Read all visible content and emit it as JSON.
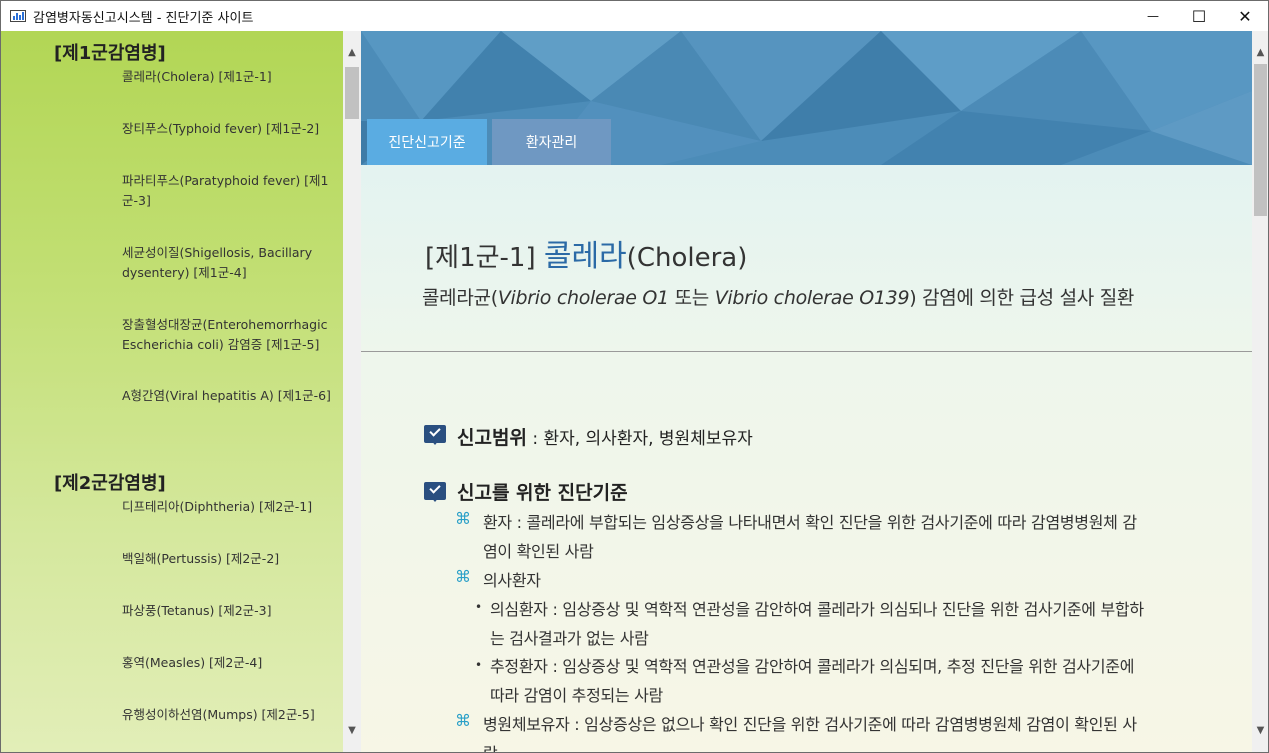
{
  "window": {
    "title": "감염병자동신고시스템 - 진단기준 사이트",
    "minimize_glyph": "—",
    "maximize_glyph": "☐",
    "close_glyph": "✕"
  },
  "sidebar": {
    "groups": [
      {
        "title": "[제1군감염병]",
        "items": [
          "콜레라(Cholera) [제1군-1]",
          "장티푸스(Typhoid fever) [제1군-2]",
          "파라티푸스(Paratyphoid fever) [제1군-3]",
          "세균성이질(Shigellosis, Bacillary dysentery) [제1군-4]",
          "장출혈성대장균(Enterohemorrhagic Escherichia coli) 감염증 [제1군-5]",
          "A형간염(Viral hepatitis A) [제1군-6]"
        ]
      },
      {
        "title": "[제2군감염병]",
        "items": [
          "디프테리아(Diphtheria) [제2군-1]",
          "백일해(Pertussis) [제2군-2]",
          "파상풍(Tetanus) [제2군-3]",
          "홍역(Measles) [제2군-4]",
          "유행성이하선염(Mumps) [제2군-5]"
        ]
      }
    ]
  },
  "tabs": {
    "active": "진단신고기준",
    "inactive": "환자관리"
  },
  "disease": {
    "code": "[제1군-1]",
    "name_ko": "콜레라",
    "name_en": "(Cholera)",
    "desc_pre": "콜레라균(",
    "desc_em1": "Vibrio cholerae O1",
    "desc_mid": " 또는 ",
    "desc_em2": "Vibrio cholerae O139",
    "desc_post": ") 감염에 의한 급성 설사 질환"
  },
  "report_scope": {
    "label": "신고범위",
    "text": " : 환자, 의사환자, 병원체보유자"
  },
  "criteria": {
    "label": "신고를 위한 진단기준",
    "cmd_glyph": "⌘",
    "bullet_glyph": "•",
    "patient_l1": "환자 : 콜레라에 부합되는 임상증상을 나타내면서 확인 진단을 위한 검사기준에 따라 감염병병원체 감",
    "patient_l2": "염이 확인된 사람",
    "suspect": "의사환자",
    "sub1_l1": "의심환자 : 임상증상 및 역학적 연관성을 감안하여 콜레라가 의심되나 진단을 위한 검사기준에 부합하",
    "sub1_l2": "는 검사결과가 없는 사람",
    "sub2_l1": "추정환자 : 임상증상 및 역학적 연관성을 감안하여 콜레라가 의심되며, 추정 진단을 위한 검사기준에",
    "sub2_l2": "따라 감염이 추정되는 사람",
    "carrier_l1": "병원체보유자 : 임상증상은 없으나 확인 진단을 위한 검사기준에 따라 감염병병원체 감염이 확인된 사",
    "carrier_l2": "람"
  }
}
